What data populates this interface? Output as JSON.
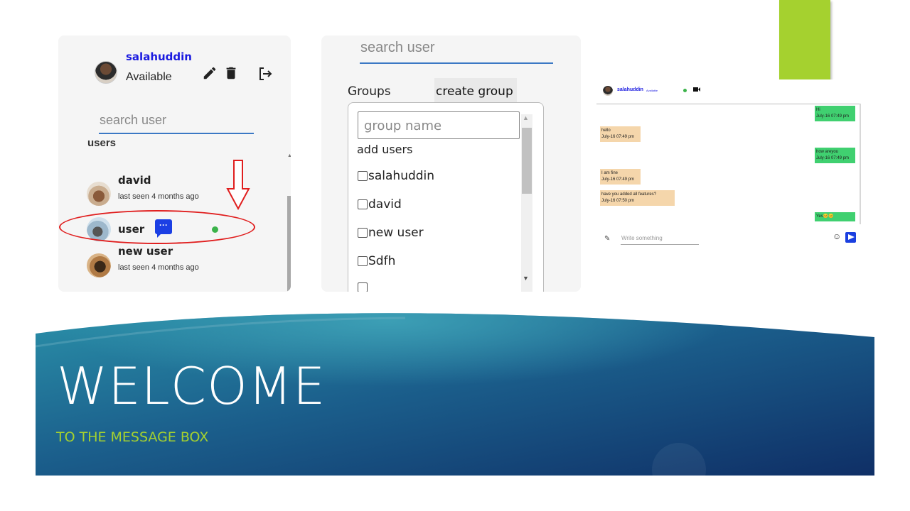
{
  "sidebar": {
    "profile_name": "salahuddin",
    "profile_status": "Available",
    "search_placeholder": "search user",
    "users_header": "users",
    "users": [
      {
        "name": "david",
        "last_seen": "last seen 4 months ago"
      },
      {
        "name": "user",
        "has_chat_badge": true,
        "online": true
      },
      {
        "name": "new user",
        "last_seen": "last seen 4 months ago"
      }
    ]
  },
  "group_panel": {
    "search_placeholder": "search user",
    "groups_label": "Groups",
    "create_group_label": "create group",
    "group_name_placeholder": "group name",
    "add_users_label": "add users",
    "users": [
      "salahuddin",
      "david",
      "new user",
      "Sdfh"
    ]
  },
  "chat": {
    "name": "salahuddin",
    "status": "Available",
    "messages": [
      {
        "direction": "out",
        "text": "Hi",
        "time": "July-16 07:49 pm"
      },
      {
        "direction": "in",
        "text": "hello",
        "time": "July-16 07:49 pm"
      },
      {
        "direction": "out",
        "text": "how areyou",
        "time": "July-16 07:49 pm"
      },
      {
        "direction": "in",
        "text": "I am fine",
        "time": "July-16 07:49 pm"
      },
      {
        "direction": "in",
        "text": "have you added all features?",
        "time": "July-16 07:50 pm"
      },
      {
        "direction": "out",
        "text": "Yes😊😊"
      }
    ],
    "input_placeholder": "Write something",
    "emoji_glyph": "☺"
  },
  "slide": {
    "title": "WELCOME",
    "subtitle": "TO THE MESSAGE BOX",
    "accent_color": "#a5d12f",
    "banner_color": "#1c5a8a"
  }
}
